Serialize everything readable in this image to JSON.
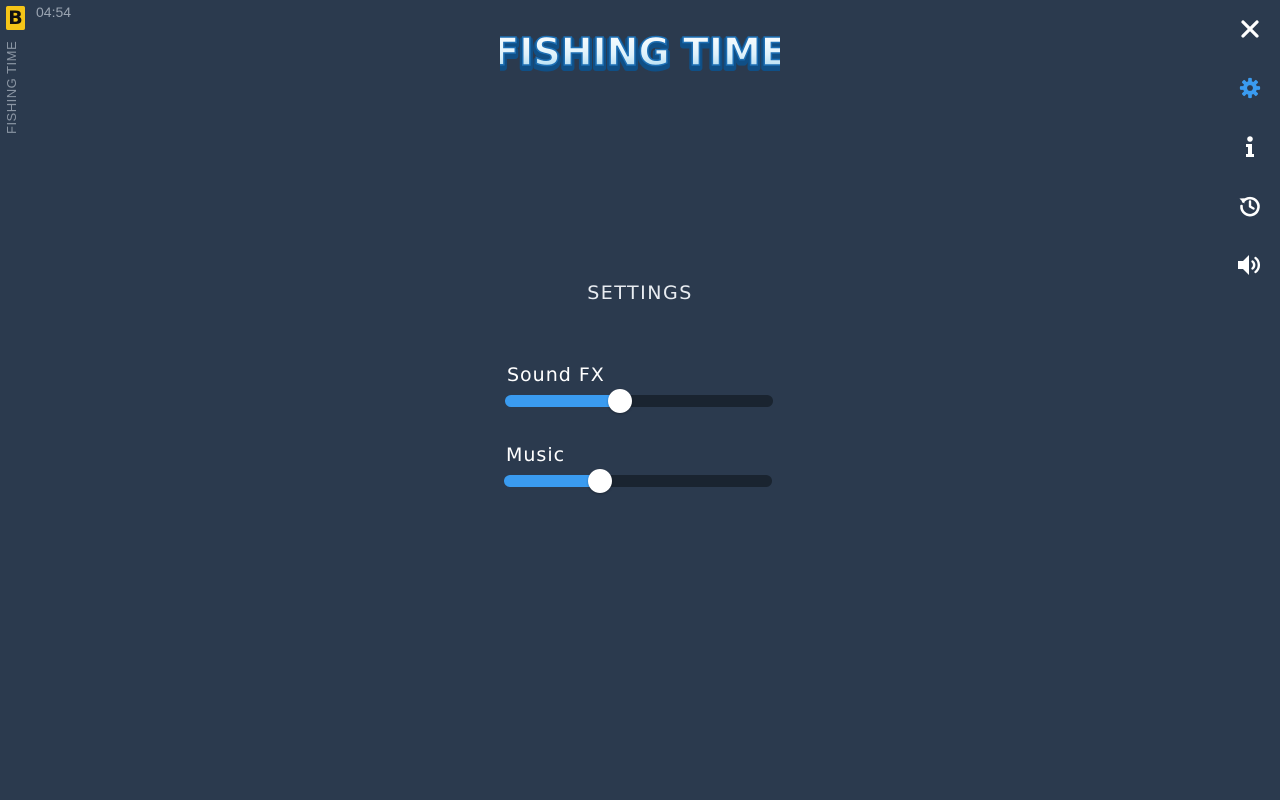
{
  "header": {
    "brand_letter": "B",
    "clock": "04:54",
    "vertical_title": "FISHING TIME",
    "logo_text": "FISHING TIME"
  },
  "toolbar": {
    "items": [
      {
        "name": "close",
        "icon": "close-icon",
        "color": "#ffffff"
      },
      {
        "name": "settings",
        "icon": "gear-icon",
        "color": "#3a9bf0",
        "active": true
      },
      {
        "name": "info",
        "icon": "info-icon",
        "color": "#ffffff"
      },
      {
        "name": "history",
        "icon": "history-icon",
        "color": "#ffffff"
      },
      {
        "name": "sound",
        "icon": "speaker-icon",
        "color": "#ffffff"
      }
    ]
  },
  "settings": {
    "title": "SETTINGS",
    "sliders": [
      {
        "label": "Sound FX",
        "value": 0.43
      },
      {
        "label": "Music",
        "value": 0.36
      }
    ]
  },
  "colors": {
    "background": "#2b3a4e",
    "accent": "#3a9bf0",
    "track": "#1a2430",
    "brand": "#f5c518"
  }
}
